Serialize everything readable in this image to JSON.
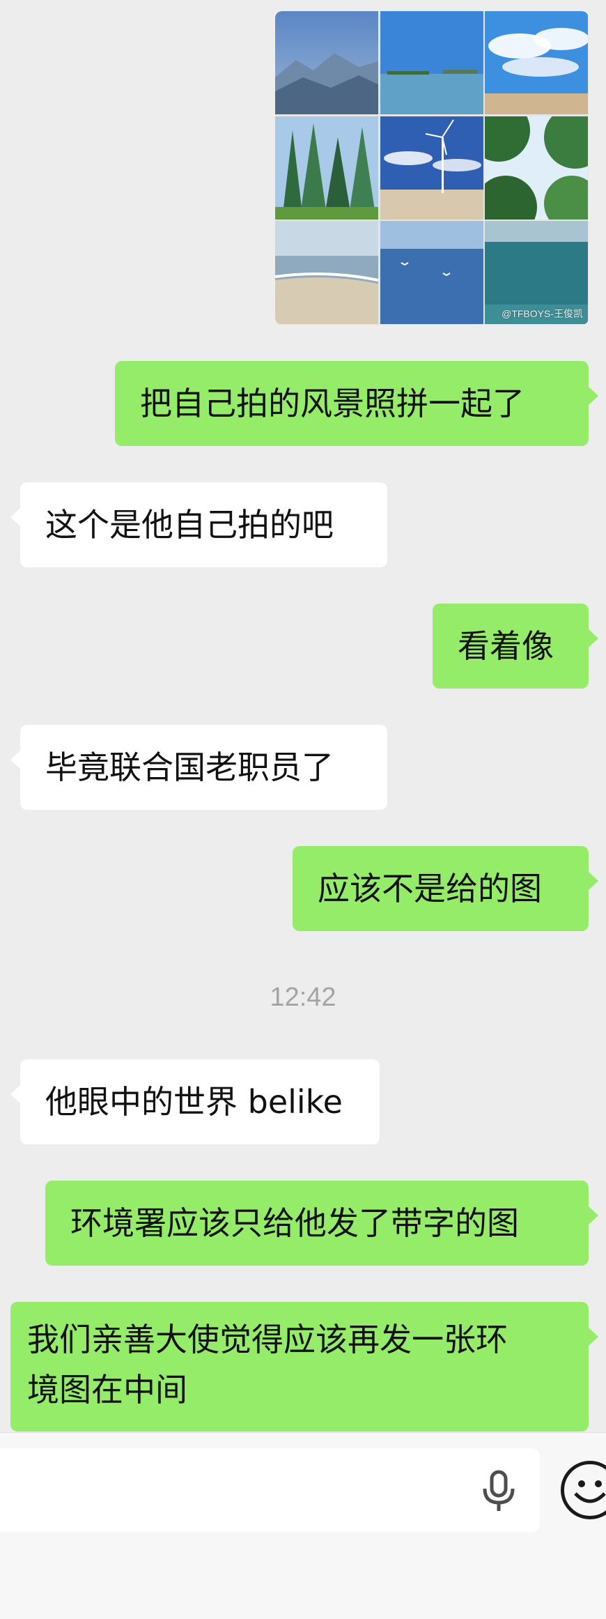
{
  "collage": {
    "watermark": "@TFBOYS-王俊凯",
    "tiles": [
      {
        "icon": "mountain-photo-icon"
      },
      {
        "icon": "sea-photo-icon"
      },
      {
        "icon": "sky-clouds-photo-icon"
      },
      {
        "icon": "forest-photo-icon"
      },
      {
        "icon": "wind-turbine-photo-icon"
      },
      {
        "icon": "tree-canopy-photo-icon"
      },
      {
        "icon": "beach-seagulls-photo-icon"
      },
      {
        "icon": "ocean-birds-photo-icon"
      },
      {
        "icon": "ocean-horizon-photo-icon"
      }
    ]
  },
  "messages": [
    {
      "direction": "out",
      "text": "把自己拍的风景照拼一起了"
    },
    {
      "direction": "in",
      "text": "这个是他自己拍的吧"
    },
    {
      "direction": "out",
      "text": "看着像"
    },
    {
      "direction": "in",
      "text": "毕竟联合国老职员了"
    },
    {
      "direction": "out",
      "text": "应该不是给的图"
    },
    {
      "direction": "in",
      "text": "他眼中的世界 belike"
    },
    {
      "direction": "out",
      "text": "环境署应该只给他发了带字的图"
    },
    {
      "direction": "out",
      "text_line1": "我们亲善大使觉得应该再发一张环",
      "text_line2": "境图在中间"
    }
  ],
  "timestamp": "12:42",
  "input_bar": {
    "text_value": "",
    "mic_icon": "microphone-icon",
    "emoji_icon": "emoji-smile-icon"
  },
  "colors": {
    "background": "#ededed",
    "outgoing_bubble": "#95ec69",
    "incoming_bubble": "#ffffff",
    "timestamp_text": "#a3a3a3"
  }
}
